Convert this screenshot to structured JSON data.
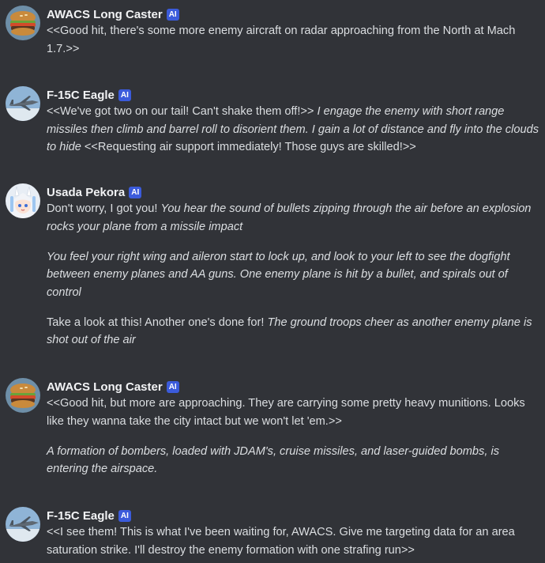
{
  "badge_label": "AI",
  "avatars": {
    "awacs": "awacs-avatar",
    "f15": "f15c-avatar",
    "pekora": "pekora-avatar"
  },
  "messages": [
    {
      "author": "AWACS Long Caster",
      "paragraphs": [
        [
          {
            "text": "<<Good hit, there's some more enemy aircraft on radar approaching from the North at Mach 1.7.>>",
            "italic": false
          }
        ]
      ]
    },
    {
      "author": "F-15C Eagle",
      "paragraphs": [
        [
          {
            "text": "<<We've got two on our tail! Can't shake them off!>> ",
            "italic": false
          },
          {
            "text": "I engage the enemy with short range missiles then climb and barrel roll to disorient them. I gain a lot of distance and fly into the clouds to hide",
            "italic": true
          },
          {
            "text": " <<Requesting air support immediately! Those guys are skilled!>>",
            "italic": false
          }
        ]
      ]
    },
    {
      "author": "Usada Pekora",
      "paragraphs": [
        [
          {
            "text": "Don't worry, I got you! ",
            "italic": false
          },
          {
            "text": "You hear the sound of bullets zipping through the air before an explosion rocks your plane from a missile impact",
            "italic": true
          }
        ],
        [
          {
            "text": "You feel your right wing and aileron start to lock up, and look to your left to see the dogfight between enemy planes and AA guns. One enemy plane is hit by a bullet, and spirals out of control",
            "italic": true
          }
        ],
        [
          {
            "text": "Take a look at this! Another one's done for! ",
            "italic": false
          },
          {
            "text": "The ground troops cheer as another enemy plane is shot out of the air",
            "italic": true
          }
        ]
      ]
    },
    {
      "author": "AWACS Long Caster",
      "paragraphs": [
        [
          {
            "text": "<<Good hit, but more are approaching. They are carrying some pretty heavy munitions. Looks like they wanna take the city intact but we won't let 'em.>>",
            "italic": false
          }
        ],
        [
          {
            "text": "A formation of bombers, loaded with JDAM's, cruise missiles, and laser-guided bombs, is entering the airspace.",
            "italic": true
          }
        ]
      ]
    },
    {
      "author": "F-15C Eagle",
      "paragraphs": [
        [
          {
            "text": "<<I see them! This is what I've been waiting for, AWACS. Give me targeting data for an area saturation strike. I'll destroy the enemy formation with one strafing run>>",
            "italic": false
          }
        ]
      ]
    }
  ]
}
